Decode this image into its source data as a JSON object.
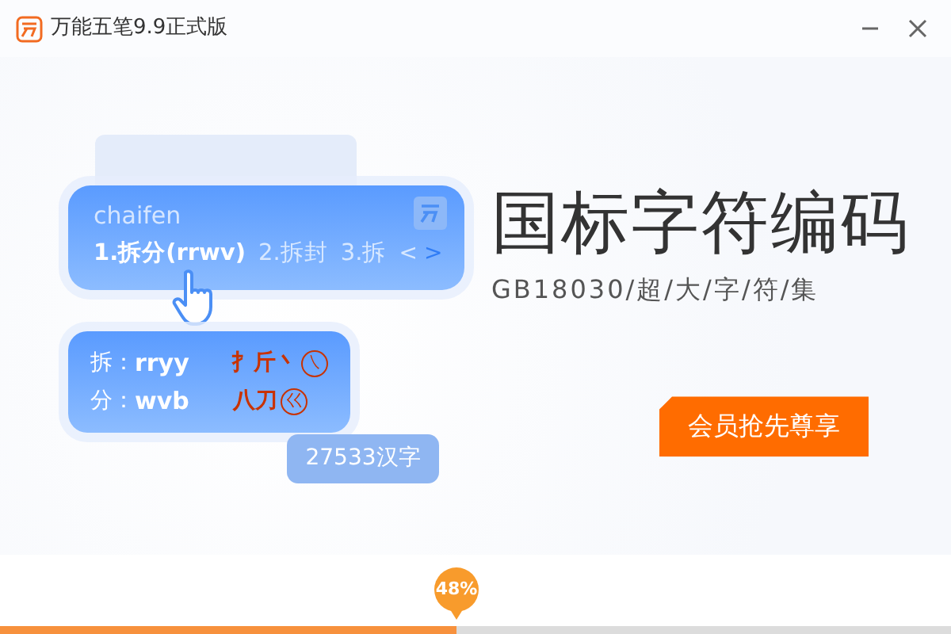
{
  "window": {
    "title": "万能五笔9.9正式版"
  },
  "demo": {
    "input": "chaifen",
    "candidates": [
      {
        "label": "1.拆分(rrwv)",
        "selected": true
      },
      {
        "label": "2.拆封",
        "selected": false
      },
      {
        "label": "3.拆",
        "selected": false
      }
    ],
    "paging": [
      {
        "glyph": "<",
        "disabled": true
      },
      {
        "glyph": ">",
        "disabled": false
      }
    ],
    "codes": [
      {
        "char": "拆：",
        "code": "rryy",
        "roots": "扌斤丶",
        "key_root": "㇏"
      },
      {
        "char": "分：",
        "code": "wvb",
        "roots": "八刀",
        "key_root": "巜"
      }
    ],
    "count_badge": "27533汉字"
  },
  "headline": "国标字符编码",
  "subtitle": "GB18030/超/大/字/符/集",
  "cta": "会员抢先尊享",
  "progress": {
    "level": 0.48,
    "reading": "48%"
  }
}
